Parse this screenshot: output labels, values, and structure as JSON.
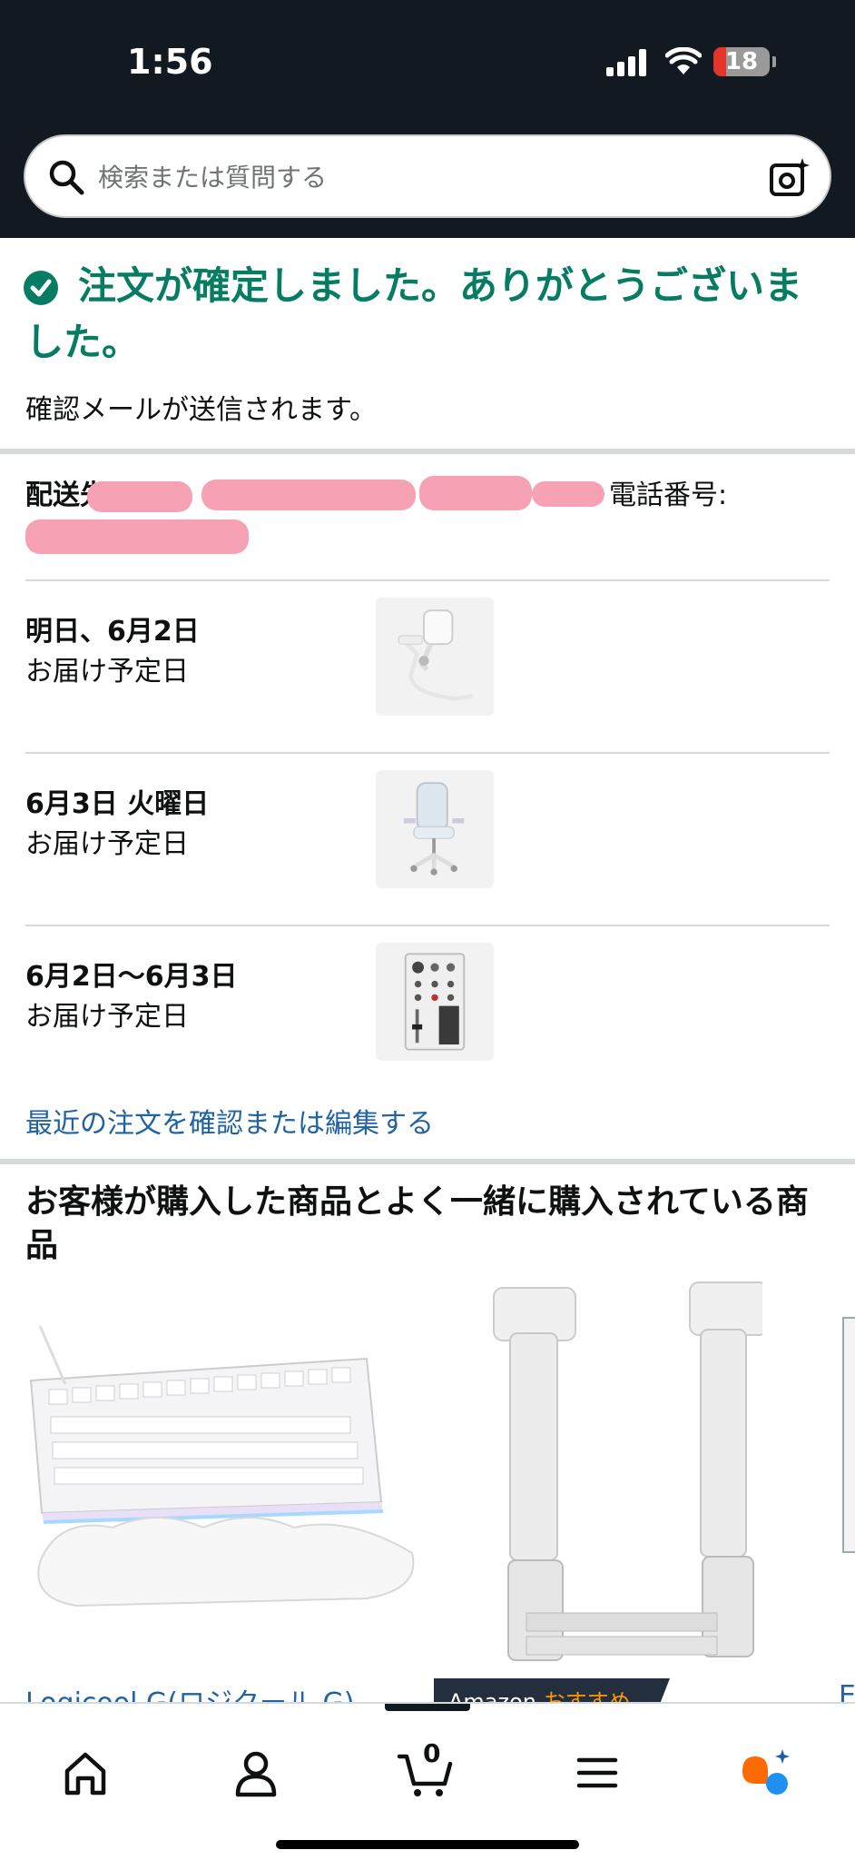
{
  "status_bar": {
    "time": "1:56",
    "battery": "18"
  },
  "search": {
    "placeholder": "検索または質問する"
  },
  "confirmation": {
    "title": "注文が確定しました。ありがとうございました。",
    "subtitle": "確認メールが送信されます。"
  },
  "shipping": {
    "label": "配送先",
    "phone_label": "電話番号:"
  },
  "deliveries": [
    {
      "date": "明日、6月2日",
      "label": "お届け予定日",
      "item_icon": "microphone-image"
    },
    {
      "date": "6月3日 火曜日",
      "label": "お届け予定日",
      "item_icon": "gaming-chair-image"
    },
    {
      "date": "6月2日〜6月3日",
      "label": "お届け予定日",
      "item_icon": "audio-mixer-image"
    }
  ],
  "edit_link": "最近の注文を確認または編集する",
  "recommendations": {
    "title": "お客様が購入した商品とよく一緒に購入されている商品",
    "items": [
      {
        "title": "Logicool G(ロジクール G)…",
        "icon": "keyboard-image"
      },
      {
        "badge_prefix": "Amazon",
        "badge_suffix": "おすすめ",
        "icon": "monitor-arm-image"
      }
    ],
    "edge_text": "E"
  },
  "bottom_nav": {
    "items": [
      "home-icon",
      "account-icon",
      "cart-icon",
      "menu-icon",
      "rufus-ai-icon"
    ],
    "cart_count": "0"
  },
  "colors": {
    "header": "#131921",
    "success": "#067d62",
    "link": "#2162a1",
    "accent": "#ff9900"
  }
}
